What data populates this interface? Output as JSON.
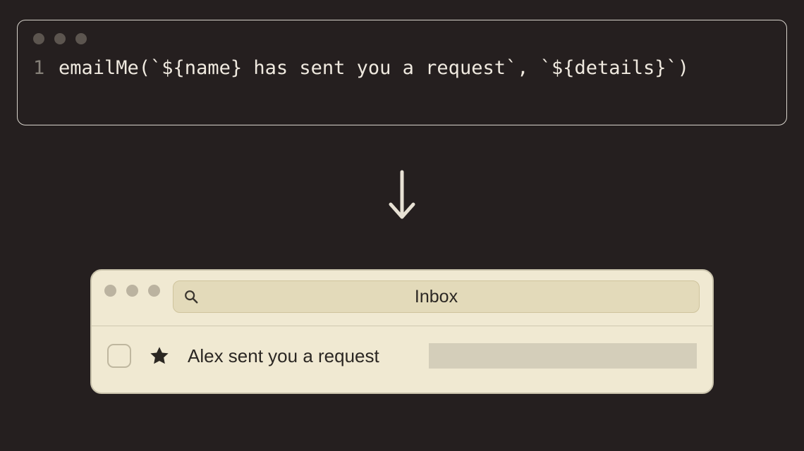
{
  "code": {
    "line_number": "1",
    "content": "emailMe(`${name} has sent you a request`, `${details}`)"
  },
  "mail": {
    "title": "Inbox",
    "row": {
      "subject": "Alex sent you a request"
    }
  }
}
